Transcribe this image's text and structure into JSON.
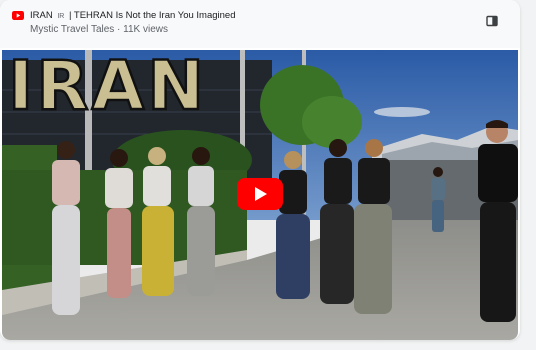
{
  "video": {
    "title_prefix": "IRAN",
    "title_tag": "IR",
    "title_rest": "| TEHRAN Is Not the Iran You Imagined",
    "channel_line": "Mystic Travel Tales · 11K views",
    "overlay_text": "IRAN",
    "brand_color": "#ff0000"
  },
  "icons": {
    "logo": "youtube-logo-icon",
    "panel": "sidebar-toggle-icon",
    "play": "play-icon"
  }
}
